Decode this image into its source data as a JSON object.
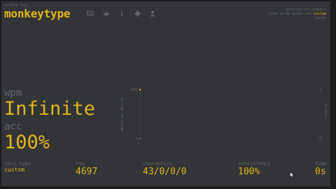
{
  "header": {
    "small_text": "monkey see",
    "logo": "monkeytype",
    "nav_icons": [
      "keyboard-icon",
      "crown-icon",
      "info-icon",
      "gear-icon",
      "user-icon"
    ]
  },
  "settings_info": {
    "line1": "punctuation numbers",
    "line2_prefix": "time words quote zen",
    "line2_active": "custom",
    "line3": "change"
  },
  "results": {
    "wpm_label": "wpm",
    "wpm_value": "Infinite",
    "acc_label": "acc",
    "acc_value": "100%"
  },
  "chart_data": {
    "type": "line",
    "ylabel": "Words per Minute",
    "y2label": "Errors",
    "y_ticks": [
      "4697",
      "0"
    ],
    "y2_ticks": [
      "1",
      "0"
    ],
    "x_ticks": [
      "1"
    ],
    "series": [
      {
        "values": [
          4697
        ]
      }
    ],
    "ylim": [
      0,
      4697
    ],
    "y2lim": [
      0,
      1
    ]
  },
  "stats": {
    "test_type_label": "test type",
    "test_type_value": "custom",
    "raw_label": "raw",
    "raw_value": "4697",
    "characters_label": "characters",
    "characters_value": "43/0/0/0",
    "consistency_label": "consistency",
    "consistency_value": "100%",
    "time_label": "time",
    "time_value": "0s"
  },
  "colors": {
    "background": "#323437",
    "main": "#e2b714",
    "sub": "#646669"
  }
}
